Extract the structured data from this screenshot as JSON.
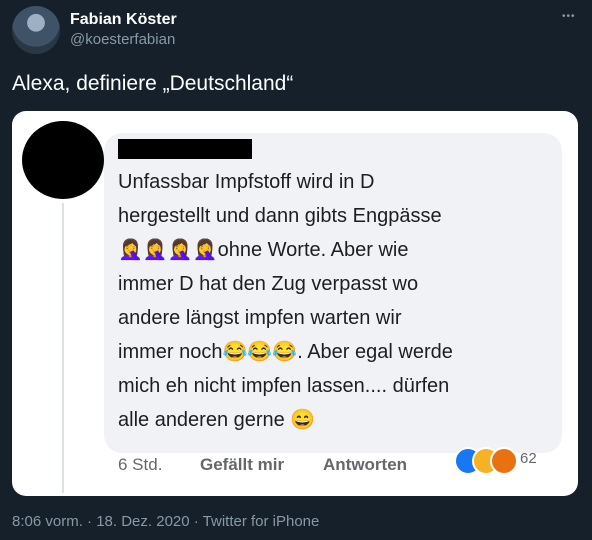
{
  "tweet": {
    "author_name": "Fabian Köster",
    "author_handle": "@koesterfabian",
    "text": "Alexa, definiere „Deutschland“",
    "meta": "8:06 vorm. · 18. Dez. 2020 · Twitter for iPhone"
  },
  "embedded": {
    "comment_line_1": "Unfassbar Impfstoff wird in D",
    "comment_line_2": "hergestellt und dann gibts Engpässe",
    "facepalm_emojis": "🤦‍♀️🤦‍♀️🤦‍♀️🤦‍♀️",
    "comment_line_3": "ohne Worte. Aber wie",
    "comment_line_4": "immer D hat den Zug verpasst wo",
    "comment_line_5": "andere längst impfen warten wir",
    "comment_line_6a": "immer noch",
    "crying_laugh_emojis": "😂😂😂",
    "comment_line_6b": ". Aber egal werde",
    "comment_line_7": "mich eh nicht impfen lassen.... dürfen",
    "comment_line_8": "alle anderen gerne ",
    "smile_emoji": "😄",
    "time": "6 Std.",
    "like_label": "Gefällt mir",
    "reply_label": "Antworten",
    "reaction_count": "62"
  },
  "icons": {
    "more": "ellipsis-icon",
    "reactions": [
      "like-icon",
      "haha-icon",
      "angry-icon"
    ]
  }
}
